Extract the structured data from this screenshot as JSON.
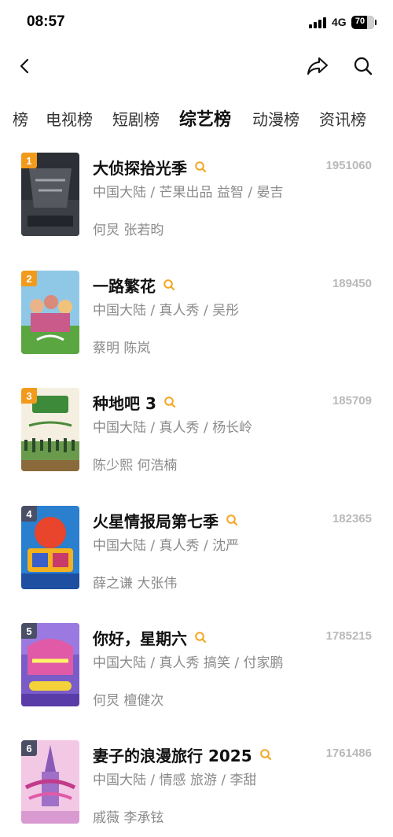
{
  "status_bar": {
    "time": "08:57",
    "network": "4G",
    "battery_label": "70",
    "battery_level": 0.7
  },
  "nav": {
    "back_icon": "back-arrow-icon",
    "share_icon": "share-icon",
    "search_icon": "search-icon"
  },
  "tabs": [
    {
      "label": "榜",
      "active": false
    },
    {
      "label": "电视榜",
      "active": false
    },
    {
      "label": "短剧榜",
      "active": false
    },
    {
      "label": "综艺榜",
      "active": true
    },
    {
      "label": "动漫榜",
      "active": false
    },
    {
      "label": "资讯榜",
      "active": false
    }
  ],
  "colors": {
    "rank_top3": "#f29a1c",
    "rank_other": "#4a4f66",
    "search_accent": "#f5a623",
    "meta_text": "#8a8a8a",
    "heat_text": "#b9b9b9"
  },
  "list": [
    {
      "rank": "1",
      "title": "大侦探拾光季",
      "meta": "中国大陆 / 芒果出品 益智 / 晏吉",
      "cast": "何炅 张若昀",
      "heat": "1951060"
    },
    {
      "rank": "2",
      "title": "一路繁花",
      "meta": "中国大陆 / 真人秀 / 吴彤",
      "cast": "蔡明 陈岚",
      "heat": "189450"
    },
    {
      "rank": "3",
      "title": "种地吧 3",
      "meta": "中国大陆 / 真人秀 / 杨长岭",
      "cast": "陈少熙 何浩楠",
      "heat": "185709"
    },
    {
      "rank": "4",
      "title": "火星情报局第七季",
      "meta": "中国大陆 / 真人秀 / 沈严",
      "cast": "薛之谦 大张伟",
      "heat": "182365"
    },
    {
      "rank": "5",
      "title": "你好，星期六",
      "meta": "中国大陆 / 真人秀 搞笑 / 付家鹏",
      "cast": "何炅 檀健次",
      "heat": "1785215"
    },
    {
      "rank": "6",
      "title": "妻子的浪漫旅行 2025",
      "meta": "中国大陆 / 情感 旅游 / 李甜",
      "cast": "戚薇 李承铉",
      "heat": "1761486"
    }
  ]
}
